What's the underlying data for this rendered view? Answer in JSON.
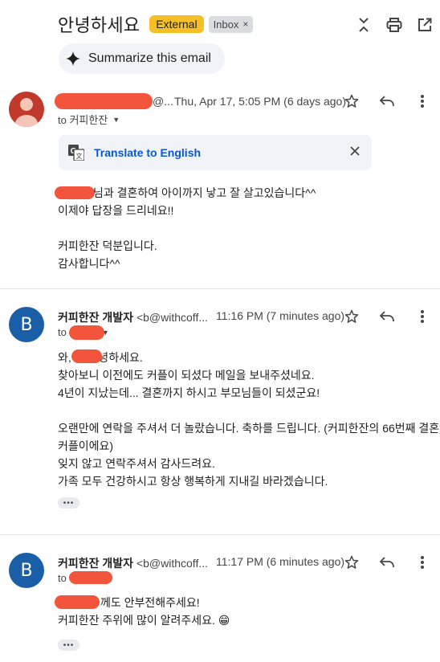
{
  "header": {
    "subject": "안녕하세요",
    "labels": {
      "external": "External",
      "inbox": "Inbox",
      "inbox_remove": "×"
    },
    "icons": [
      "collapse-icon",
      "print-icon",
      "open-in-new-window-icon"
    ]
  },
  "summarize": {
    "label": "Summarize this email",
    "icon": "sparkle-icon"
  },
  "messages": [
    {
      "sender_suffix": "@...",
      "time": "Thu, Apr 17, 5:05 PM (6 days ago)",
      "to": "to 커피한잔",
      "translate": {
        "label": "Translate to English"
      },
      "lines": [
        "님과 결혼하여 아이까지 낳고 잘 살고있습니다^^",
        "이제야 답장을 드리네요!!",
        "",
        "커피한잔 덕분입니다.",
        "감사합니다^^"
      ]
    },
    {
      "avatar": "B",
      "sender_name": "커피한잔 개발자",
      "sender_addr": "<b@withcoff...",
      "time": "11:16 PM (7 minutes ago)",
      "to": "to",
      "lines": [
        "와, 님 안녕하세요.",
        "찾아보니 이전에도 커플이 되셨다 메일을 보내주셨네요.",
        "4년이 지났는데... 결혼까지 하시고 부모님들이 되셨군요!",
        "",
        "오랜만에 연락을 주셔서 더 놀랐습니다. 축하를 드립니다. (커피한잔의 66번째 결혼",
        "커플이에요)",
        "잊지 않고 연락주셔서 감사드려요.",
        "가족 모두 건강하시고 항상 행복하게 지내길 바라겠습니다."
      ]
    },
    {
      "avatar": "B",
      "sender_name": "커피한잔 개발자",
      "sender_addr": "<b@withcoff...",
      "time": "11:17 PM (6 minutes ago)",
      "to": "to",
      "lines": [
        "께도 안부전해주세요!",
        "커피한잔 주위에 많이 알려주세요. 😁"
      ]
    }
  ],
  "colors": {
    "external_label": "#f6bf26",
    "link_blue": "#0b57d0",
    "redaction": "#f2553b",
    "avatar_blue": "#1a5ea8"
  }
}
